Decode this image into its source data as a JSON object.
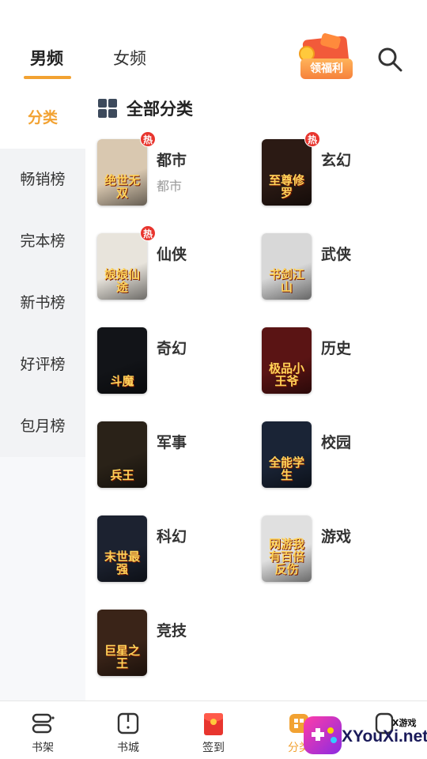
{
  "header": {
    "tabs": [
      {
        "label": "男频",
        "active": true
      },
      {
        "label": "女频",
        "active": false
      }
    ],
    "reward_label": "领福利",
    "search_icon": "search-icon",
    "accent_color": "#f2a232"
  },
  "sidebar": {
    "items": [
      {
        "label": "分类",
        "active": true
      },
      {
        "label": "畅销榜"
      },
      {
        "label": "完本榜"
      },
      {
        "label": "新书榜"
      },
      {
        "label": "好评榜"
      },
      {
        "label": "包月榜"
      }
    ]
  },
  "content": {
    "section_title": "全部分类",
    "section_icon": "grid-icon",
    "hot_badge": "热",
    "categories": [
      {
        "name": "都市",
        "sub": "都市",
        "hot": true,
        "cover_text": "绝世无双",
        "cover_color": "#d9c8b0"
      },
      {
        "name": "玄幻",
        "hot": true,
        "cover_text": "至尊修罗",
        "cover_color": "#2b1a14"
      },
      {
        "name": "仙侠",
        "hot": true,
        "cover_text": "娘娘仙途",
        "cover_color": "#e8e4dc"
      },
      {
        "name": "武侠",
        "cover_text": "书剑江山",
        "cover_color": "#d8d8d8"
      },
      {
        "name": "奇幻",
        "cover_text": "斗魔",
        "cover_color": "#121418"
      },
      {
        "name": "历史",
        "cover_text": "极品小王爷",
        "cover_color": "#5a1414"
      },
      {
        "name": "军事",
        "cover_text": "兵王",
        "cover_color": "#2a2218"
      },
      {
        "name": "校园",
        "cover_text": "全能学生",
        "cover_color": "#1a2436"
      },
      {
        "name": "科幻",
        "cover_text": "末世最强",
        "cover_color": "#1c2230"
      },
      {
        "name": "游戏",
        "cover_text": "网游我有百倍反伤",
        "cover_color": "#e0e0e0"
      },
      {
        "name": "竞技",
        "cover_text": "巨星之王",
        "cover_color": "#3a2418"
      }
    ]
  },
  "bottom_nav": {
    "items": [
      {
        "label": "书架",
        "icon": "bookshelf-icon"
      },
      {
        "label": "书城",
        "icon": "bookstore-icon"
      },
      {
        "label": "签到",
        "icon": "red-envelope-icon"
      },
      {
        "label": "分类",
        "icon": "category-icon",
        "active": true
      },
      {
        "label": "",
        "icon": "profile-icon"
      }
    ]
  },
  "watermark": {
    "small_text": "X游戏",
    "big_text": "XYouXi.net"
  }
}
